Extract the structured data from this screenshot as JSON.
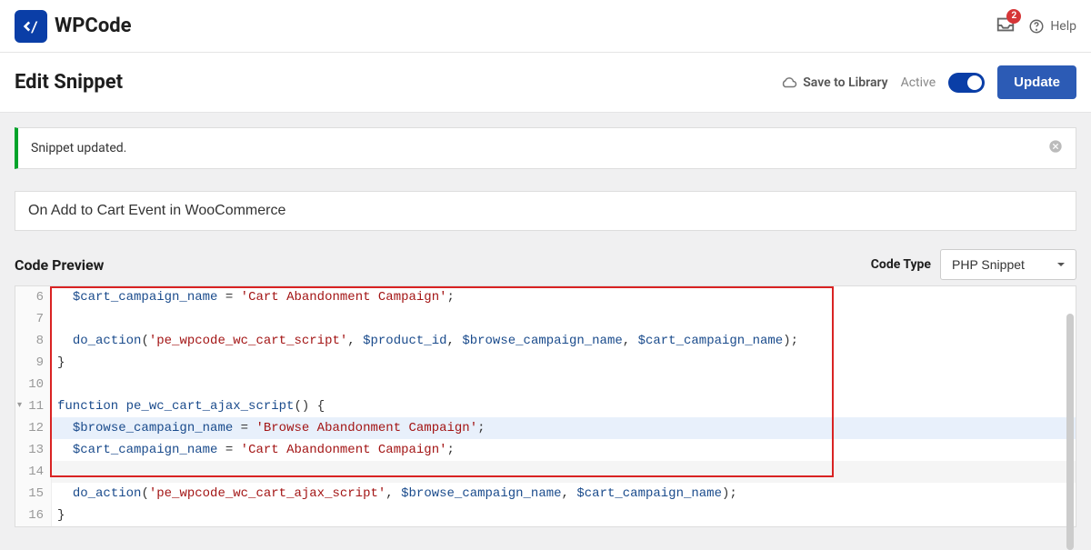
{
  "brand": {
    "name": "WPCode"
  },
  "notifications": {
    "count": "2"
  },
  "help": {
    "label": "Help"
  },
  "page": {
    "title": "Edit Snippet"
  },
  "actions": {
    "save_library": "Save to Library",
    "active_label": "Active",
    "update_label": "Update"
  },
  "alert": {
    "message": "Snippet updated."
  },
  "snippet": {
    "title": "On Add to Cart Event in WooCommerce"
  },
  "sections": {
    "code_preview": "Code Preview",
    "code_type_label": "Code Type",
    "code_type_value": "PHP Snippet"
  },
  "code": {
    "lines": [
      {
        "n": "6",
        "indent": "  ",
        "tokens": [
          [
            "var",
            "$cart_campaign_name"
          ],
          [
            "txt",
            " "
          ],
          [
            "op",
            "="
          ],
          [
            "txt",
            " "
          ],
          [
            "str",
            "'Cart Abandonment Campaign'"
          ],
          [
            "punct",
            ";"
          ]
        ]
      },
      {
        "n": "7",
        "indent": "",
        "tokens": []
      },
      {
        "n": "8",
        "indent": "  ",
        "tokens": [
          [
            "fn",
            "do_action"
          ],
          [
            "punct",
            "("
          ],
          [
            "str",
            "'pe_wpcode_wc_cart_script'"
          ],
          [
            "punct",
            ","
          ],
          [
            "txt",
            " "
          ],
          [
            "var",
            "$product_id"
          ],
          [
            "punct",
            ","
          ],
          [
            "txt",
            " "
          ],
          [
            "var",
            "$browse_campaign_name"
          ],
          [
            "punct",
            ","
          ],
          [
            "txt",
            " "
          ],
          [
            "var",
            "$cart_campaign_name"
          ],
          [
            "punct",
            ")"
          ],
          [
            "punct",
            ";"
          ]
        ]
      },
      {
        "n": "9",
        "indent": "",
        "tokens": [
          [
            "punct",
            "}"
          ]
        ]
      },
      {
        "n": "10",
        "indent": "",
        "tokens": []
      },
      {
        "n": "11",
        "indent": "",
        "fold": true,
        "tokens": [
          [
            "kw",
            "function"
          ],
          [
            "txt",
            " "
          ],
          [
            "fn",
            "pe_wc_cart_ajax_script"
          ],
          [
            "punct",
            "()"
          ],
          [
            "txt",
            " "
          ],
          [
            "punct",
            "{"
          ]
        ]
      },
      {
        "n": "12",
        "indent": "  ",
        "hl": true,
        "tokens": [
          [
            "var",
            "$browse_campaign_name"
          ],
          [
            "txt",
            " "
          ],
          [
            "op",
            "="
          ],
          [
            "txt",
            " "
          ],
          [
            "str",
            "'Browse Abandonment Campaign'"
          ],
          [
            "punct",
            ";"
          ]
        ]
      },
      {
        "n": "13",
        "indent": "  ",
        "tokens": [
          [
            "var",
            "$cart_campaign_name"
          ],
          [
            "txt",
            " "
          ],
          [
            "op",
            "="
          ],
          [
            "txt",
            " "
          ],
          [
            "str",
            "'Cart Abandonment Campaign'"
          ],
          [
            "punct",
            ";"
          ]
        ]
      },
      {
        "n": "14",
        "indent": "",
        "cursor": true,
        "tokens": []
      },
      {
        "n": "15",
        "indent": "  ",
        "tokens": [
          [
            "fn",
            "do_action"
          ],
          [
            "punct",
            "("
          ],
          [
            "str",
            "'pe_wpcode_wc_cart_ajax_script'"
          ],
          [
            "punct",
            ","
          ],
          [
            "txt",
            " "
          ],
          [
            "var",
            "$browse_campaign_name"
          ],
          [
            "punct",
            ","
          ],
          [
            "txt",
            " "
          ],
          [
            "var",
            "$cart_campaign_name"
          ],
          [
            "punct",
            ")"
          ],
          [
            "punct",
            ";"
          ]
        ]
      },
      {
        "n": "16",
        "indent": "",
        "tokens": [
          [
            "punct",
            "}"
          ]
        ]
      }
    ]
  }
}
